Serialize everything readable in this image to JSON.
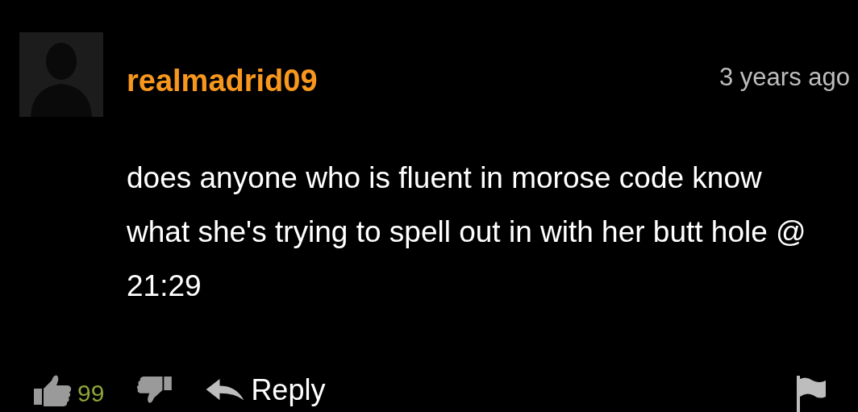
{
  "comment": {
    "username": "realmadrid09",
    "time": "3 years ago",
    "text": "does anyone who is fluent in morose code know what she's trying to spell out in with her butt hole @ 21:29",
    "likes": "99",
    "reply_label": "Reply"
  }
}
